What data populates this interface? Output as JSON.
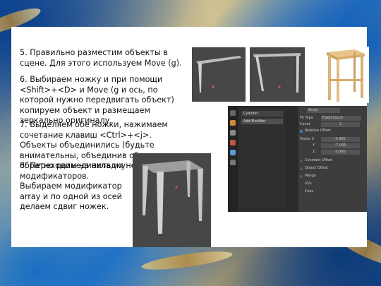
{
  "steps": {
    "s5": "5. Правильно разместим объекты в сцене. Для этого используем Move (g).",
    "s6": "6. Выбираем ножку и при помощи <Shift>+<D> и Move (g и ось, по которой нужно передвигать объект) копируем объект и размещаем зеркально оригиналу.",
    "s7": "7.  Выделяем обе ножки, нажимаем сочетание клавиш <Ctrl>+<j>. Объекты объединились (будьте внимательны, объединив объекты, обратно разъединить их не получится).",
    "s8": "8. Переходим на вкладку модификаторов. Выбираем модификатор array и по одной из осей делаем сдвиг ножек."
  },
  "modifier_panel": {
    "header": "Array",
    "fit_type_label": "Fit Type",
    "fit_type_value": "Fixed Count",
    "count_label": "Count",
    "count_value": "2",
    "relative_offset_label": "Relative Offset",
    "factor_x_label": "Factor X",
    "factor_x_value": "0.000",
    "y_label": "Y",
    "y_value": "-7.000",
    "z_label": "Z",
    "z_value": "0.000",
    "constant_offset_label": "Constant Offset",
    "object_offset_label": "Object Offset",
    "merge_label": "Merge",
    "uvs_label": "UVs",
    "caps_label": "Caps"
  },
  "side_panel": {
    "object_name": "Cylinder",
    "modifier_button": "Add Modifier"
  },
  "colors": {
    "accent": "#4772b3",
    "panel": "#3d3d3d",
    "field": "#545454"
  }
}
